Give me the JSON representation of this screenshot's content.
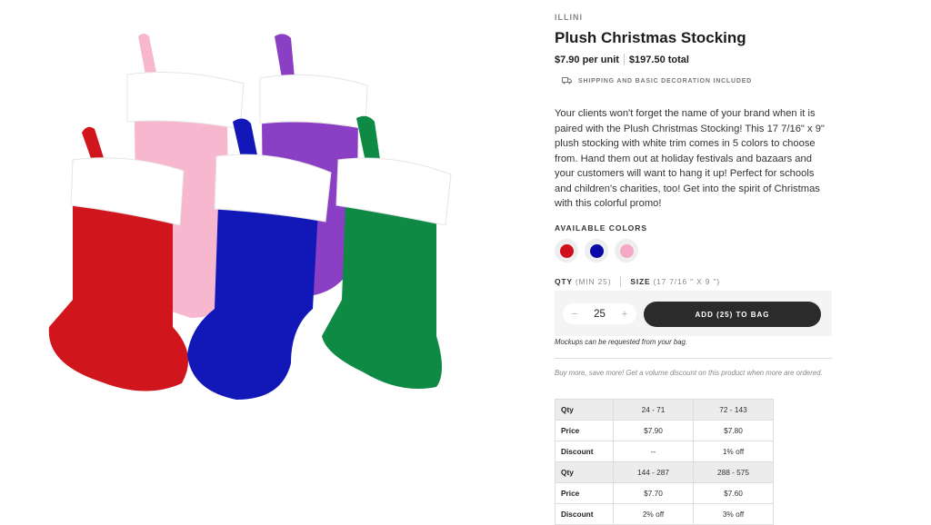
{
  "product": {
    "brand": "ILLINI",
    "title": "Plush Christmas Stocking",
    "price_per_unit": "$7.90 per unit",
    "price_total": "$197.50 total",
    "shipping_note": "SHIPPING AND BASIC DECORATION INCLUDED",
    "description": "Your clients won't forget the name of your brand when it is paired with the Plush Christmas Stocking! This 17 7/16\" x 9\" plush stocking with white trim comes in 5 colors to choose from. Hand them out at holiday festivals and bazaars and your customers will want to hang it up! Perfect for schools and children's charities, too! Get into the spirit of Christmas with this colorful promo!"
  },
  "colors": {
    "label": "AVAILABLE COLORS",
    "swatches": [
      {
        "name": "red",
        "hex": "#d0101c"
      },
      {
        "name": "blue",
        "hex": "#0a0aa8"
      },
      {
        "name": "pink",
        "hex": "#f3a9c6"
      }
    ]
  },
  "order": {
    "qty_label": "QTY",
    "qty_min": "(MIN 25)",
    "size_label": "SIZE",
    "size_value": "(17 7/16 \" X 9 \")",
    "quantity": "25",
    "decrement_symbol": "−",
    "increment_symbol": "+",
    "add_button": "ADD (25) TO BAG",
    "mockup_note": "Mockups can be requested from your bag."
  },
  "volume": {
    "note": "Buy more, save more! Get a volume discount on this product when more are ordered.",
    "rows": [
      {
        "label": "Qty",
        "a": "24 - 71",
        "b": "72 - 143"
      },
      {
        "label": "Price",
        "a": "$7.90",
        "b": "$7.80"
      },
      {
        "label": "Discount",
        "a": "--",
        "b": "1% off"
      },
      {
        "label": "Qty",
        "a": "144 - 287",
        "b": "288 - 575"
      },
      {
        "label": "Price",
        "a": "$7.70",
        "b": "$7.60"
      },
      {
        "label": "Discount",
        "a": "2% off",
        "b": "3% off"
      }
    ]
  },
  "image": {
    "stocking_colors": [
      "#f7b7cf",
      "#8a3fc4",
      "#d0151c",
      "#1218b8",
      "#0f8a45"
    ],
    "trim_color": "#ffffff"
  }
}
